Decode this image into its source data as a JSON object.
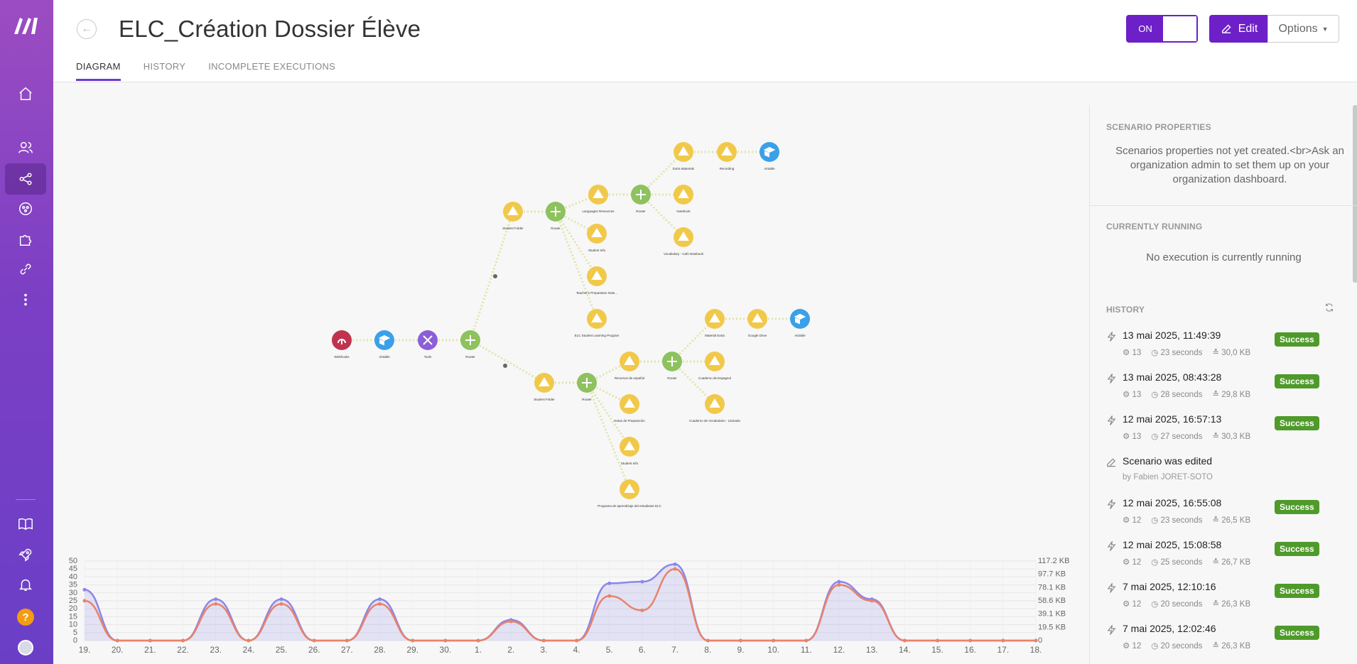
{
  "header": {
    "title": "ELC_Création Dossier Élève",
    "tabs": [
      "DIAGRAM",
      "HISTORY",
      "INCOMPLETE EXECUTIONS"
    ],
    "toggle_label": "ON",
    "edit_label": "Edit",
    "options_label": "Options"
  },
  "panel": {
    "properties_title": "SCENARIO PROPERTIES",
    "properties_text": "Scenarios properties not yet created.<br>Ask an organization admin to set them up on your organization dashboard.",
    "running_title": "CURRENTLY RUNNING",
    "running_text": "No execution is currently running",
    "history_title": "HISTORY",
    "history": [
      {
        "date": "13 mai 2025, 11:49:39",
        "ops": "13",
        "duration": "23 seconds",
        "size": "30,0 KB",
        "status": "Success"
      },
      {
        "date": "13 mai 2025, 08:43:28",
        "ops": "13",
        "duration": "28 seconds",
        "size": "29,8 KB",
        "status": "Success"
      },
      {
        "date": "12 mai 2025, 16:57:13",
        "ops": "13",
        "duration": "27 seconds",
        "size": "30,3 KB",
        "status": "Success"
      },
      {
        "date": "Scenario was edited",
        "by": "by Fabien JORET-SOTO",
        "edited": true
      },
      {
        "date": "12 mai 2025, 16:55:08",
        "ops": "12",
        "duration": "23 seconds",
        "size": "26,5 KB",
        "status": "Success"
      },
      {
        "date": "12 mai 2025, 15:08:58",
        "ops": "12",
        "duration": "25 seconds",
        "size": "26,7 KB",
        "status": "Success"
      },
      {
        "date": "7 mai 2025, 12:10:16",
        "ops": "12",
        "duration": "20 seconds",
        "size": "26,3 KB",
        "status": "Success"
      },
      {
        "date": "7 mai 2025, 12:02:46",
        "ops": "12",
        "duration": "20 seconds",
        "size": "26,3 KB",
        "status": "Success"
      }
    ]
  },
  "diagram": {
    "nodes": [
      {
        "id": "webhook",
        "label": "Webhooks",
        "color": "#c0334f",
        "kind": "webhook"
      },
      {
        "id": "airtable1",
        "label": "Airtable",
        "color": "#3aa0e8",
        "kind": "box"
      },
      {
        "id": "tools",
        "label": "Tools",
        "color": "#8b5fd6",
        "kind": "tools"
      },
      {
        "id": "router1",
        "label": "Router",
        "color": "#8dc25e",
        "kind": "router"
      },
      {
        "id": "studentfolder1",
        "label": "Student Folder",
        "color": "#f1c94a",
        "kind": "drive"
      },
      {
        "id": "router2",
        "label": "Router",
        "color": "#8dc25e",
        "kind": "router"
      },
      {
        "id": "langres",
        "label": "Languages Resources",
        "color": "#f1c94a",
        "kind": "drive"
      },
      {
        "id": "router3",
        "label": "Router",
        "color": "#8dc25e",
        "kind": "router"
      },
      {
        "id": "extramat",
        "label": "Extra Materials",
        "color": "#f1c94a",
        "kind": "drive"
      },
      {
        "id": "recording",
        "label": "Recording",
        "color": "#f1c94a",
        "kind": "drive"
      },
      {
        "id": "airtable2",
        "label": "Airtable",
        "color": "#3aa0e8",
        "kind": "box"
      },
      {
        "id": "notebook",
        "label": "Notebook",
        "color": "#f1c94a",
        "kind": "drive"
      },
      {
        "id": "vocab1",
        "label": "Vocabulary - Cahi Notebook",
        "color": "#f1c94a",
        "kind": "drive"
      },
      {
        "id": "studentinfo1",
        "label": "Student Info",
        "color": "#f1c94a",
        "kind": "drive"
      },
      {
        "id": "teacherprep",
        "label": "Teacher's Preparation Note...",
        "color": "#f1c94a",
        "kind": "drive"
      },
      {
        "id": "elcprogram",
        "label": "ELC Student Learning Program",
        "color": "#f1c94a",
        "kind": "drive"
      },
      {
        "id": "studentfolder2",
        "label": "Student Folder",
        "color": "#f1c94a",
        "kind": "drive"
      },
      {
        "id": "router4",
        "label": "Router",
        "color": "#8dc25e",
        "kind": "router"
      },
      {
        "id": "recursos",
        "label": "Recursos de español",
        "color": "#f1c94a",
        "kind": "drive"
      },
      {
        "id": "router5",
        "label": "Router",
        "color": "#8dc25e",
        "kind": "router"
      },
      {
        "id": "materialextra",
        "label": "Material Extra",
        "color": "#f1c94a",
        "kind": "drive"
      },
      {
        "id": "grabacion",
        "label": "Google Drive",
        "color": "#f1c94a",
        "kind": "drive"
      },
      {
        "id": "airtable3",
        "label": "Airtable",
        "color": "#3aa0e8",
        "kind": "box"
      },
      {
        "id": "cuaderno",
        "label": "Cuaderno de Espagnol",
        "color": "#f1c94a",
        "kind": "drive"
      },
      {
        "id": "cuadernovoc",
        "label": "Cuaderno de Vocabulario - Llamado",
        "color": "#f1c94a",
        "kind": "drive"
      },
      {
        "id": "notasprep",
        "label": "Notas de Preparación",
        "color": "#f1c94a",
        "kind": "drive"
      },
      {
        "id": "studentinfo2",
        "label": "Student Info",
        "color": "#f1c94a",
        "kind": "drive"
      },
      {
        "id": "programa",
        "label": "Programa de aprendizaje del estudiante ELC",
        "color": "#f1c94a",
        "kind": "drive"
      }
    ]
  },
  "chart_data": {
    "type": "area",
    "x": [
      "19.",
      "20.",
      "21.",
      "22.",
      "23.",
      "24.",
      "25.",
      "26.",
      "27.",
      "28.",
      "29.",
      "30.",
      "1.",
      "2.",
      "3.",
      "4.",
      "5.",
      "6.",
      "7.",
      "8.",
      "9.",
      "10.",
      "11.",
      "12.",
      "13.",
      "14.",
      "15.",
      "16.",
      "17.",
      "18."
    ],
    "y_left_ticks": [
      "0",
      "5",
      "10",
      "15",
      "20",
      "25",
      "30",
      "35",
      "40",
      "45",
      "50"
    ],
    "y_right_ticks": [
      "0",
      "19.5 KB",
      "39.1 KB",
      "58.6 KB",
      "78.1 KB",
      "97.7 KB",
      "117.2 KB"
    ],
    "ylim": [
      0,
      50
    ],
    "series": [
      {
        "color": "#8c86e8",
        "values": [
          32,
          0,
          0,
          0,
          26,
          0,
          26,
          0,
          0,
          26,
          0,
          0,
          0,
          13,
          0,
          0,
          36,
          37,
          48,
          0,
          0,
          0,
          0,
          37,
          26,
          0,
          0,
          0,
          0,
          0
        ]
      },
      {
        "color": "#e8836a",
        "values": [
          25,
          0,
          0,
          0,
          23,
          0,
          23,
          0,
          0,
          23,
          0,
          0,
          0,
          12,
          0,
          0,
          28,
          19,
          45,
          0,
          0,
          0,
          0,
          35,
          25,
          0,
          0,
          0,
          0,
          0
        ]
      }
    ]
  }
}
